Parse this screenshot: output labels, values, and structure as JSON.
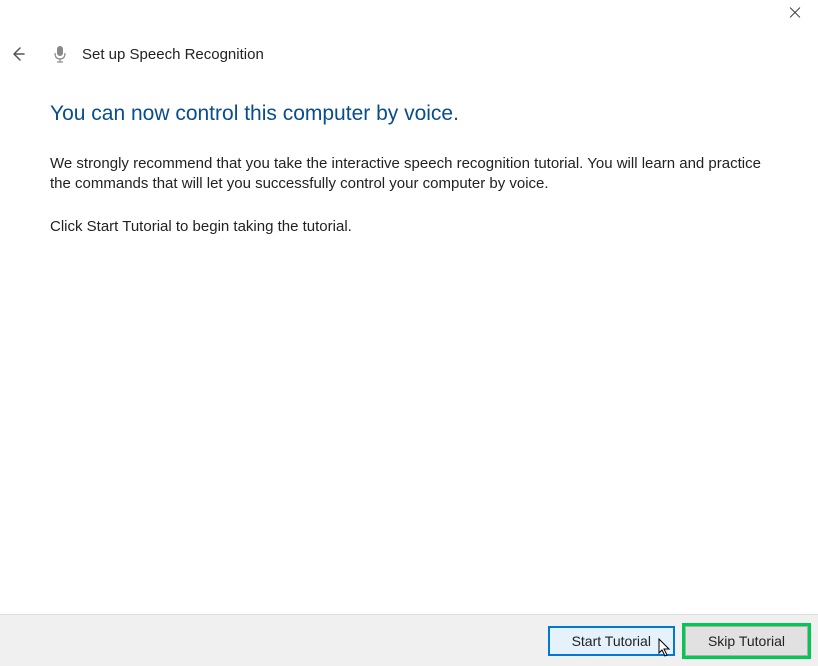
{
  "window": {
    "title": "Set up Speech Recognition"
  },
  "page": {
    "headline": "You can now control this computer by voice.",
    "paragraph1": "We strongly recommend that you take the interactive speech recognition tutorial. You will learn and practice the commands that will let you successfully control your computer by voice.",
    "paragraph2": "Click Start Tutorial to begin taking the tutorial."
  },
  "buttons": {
    "start": "Start Tutorial",
    "skip": "Skip Tutorial"
  }
}
